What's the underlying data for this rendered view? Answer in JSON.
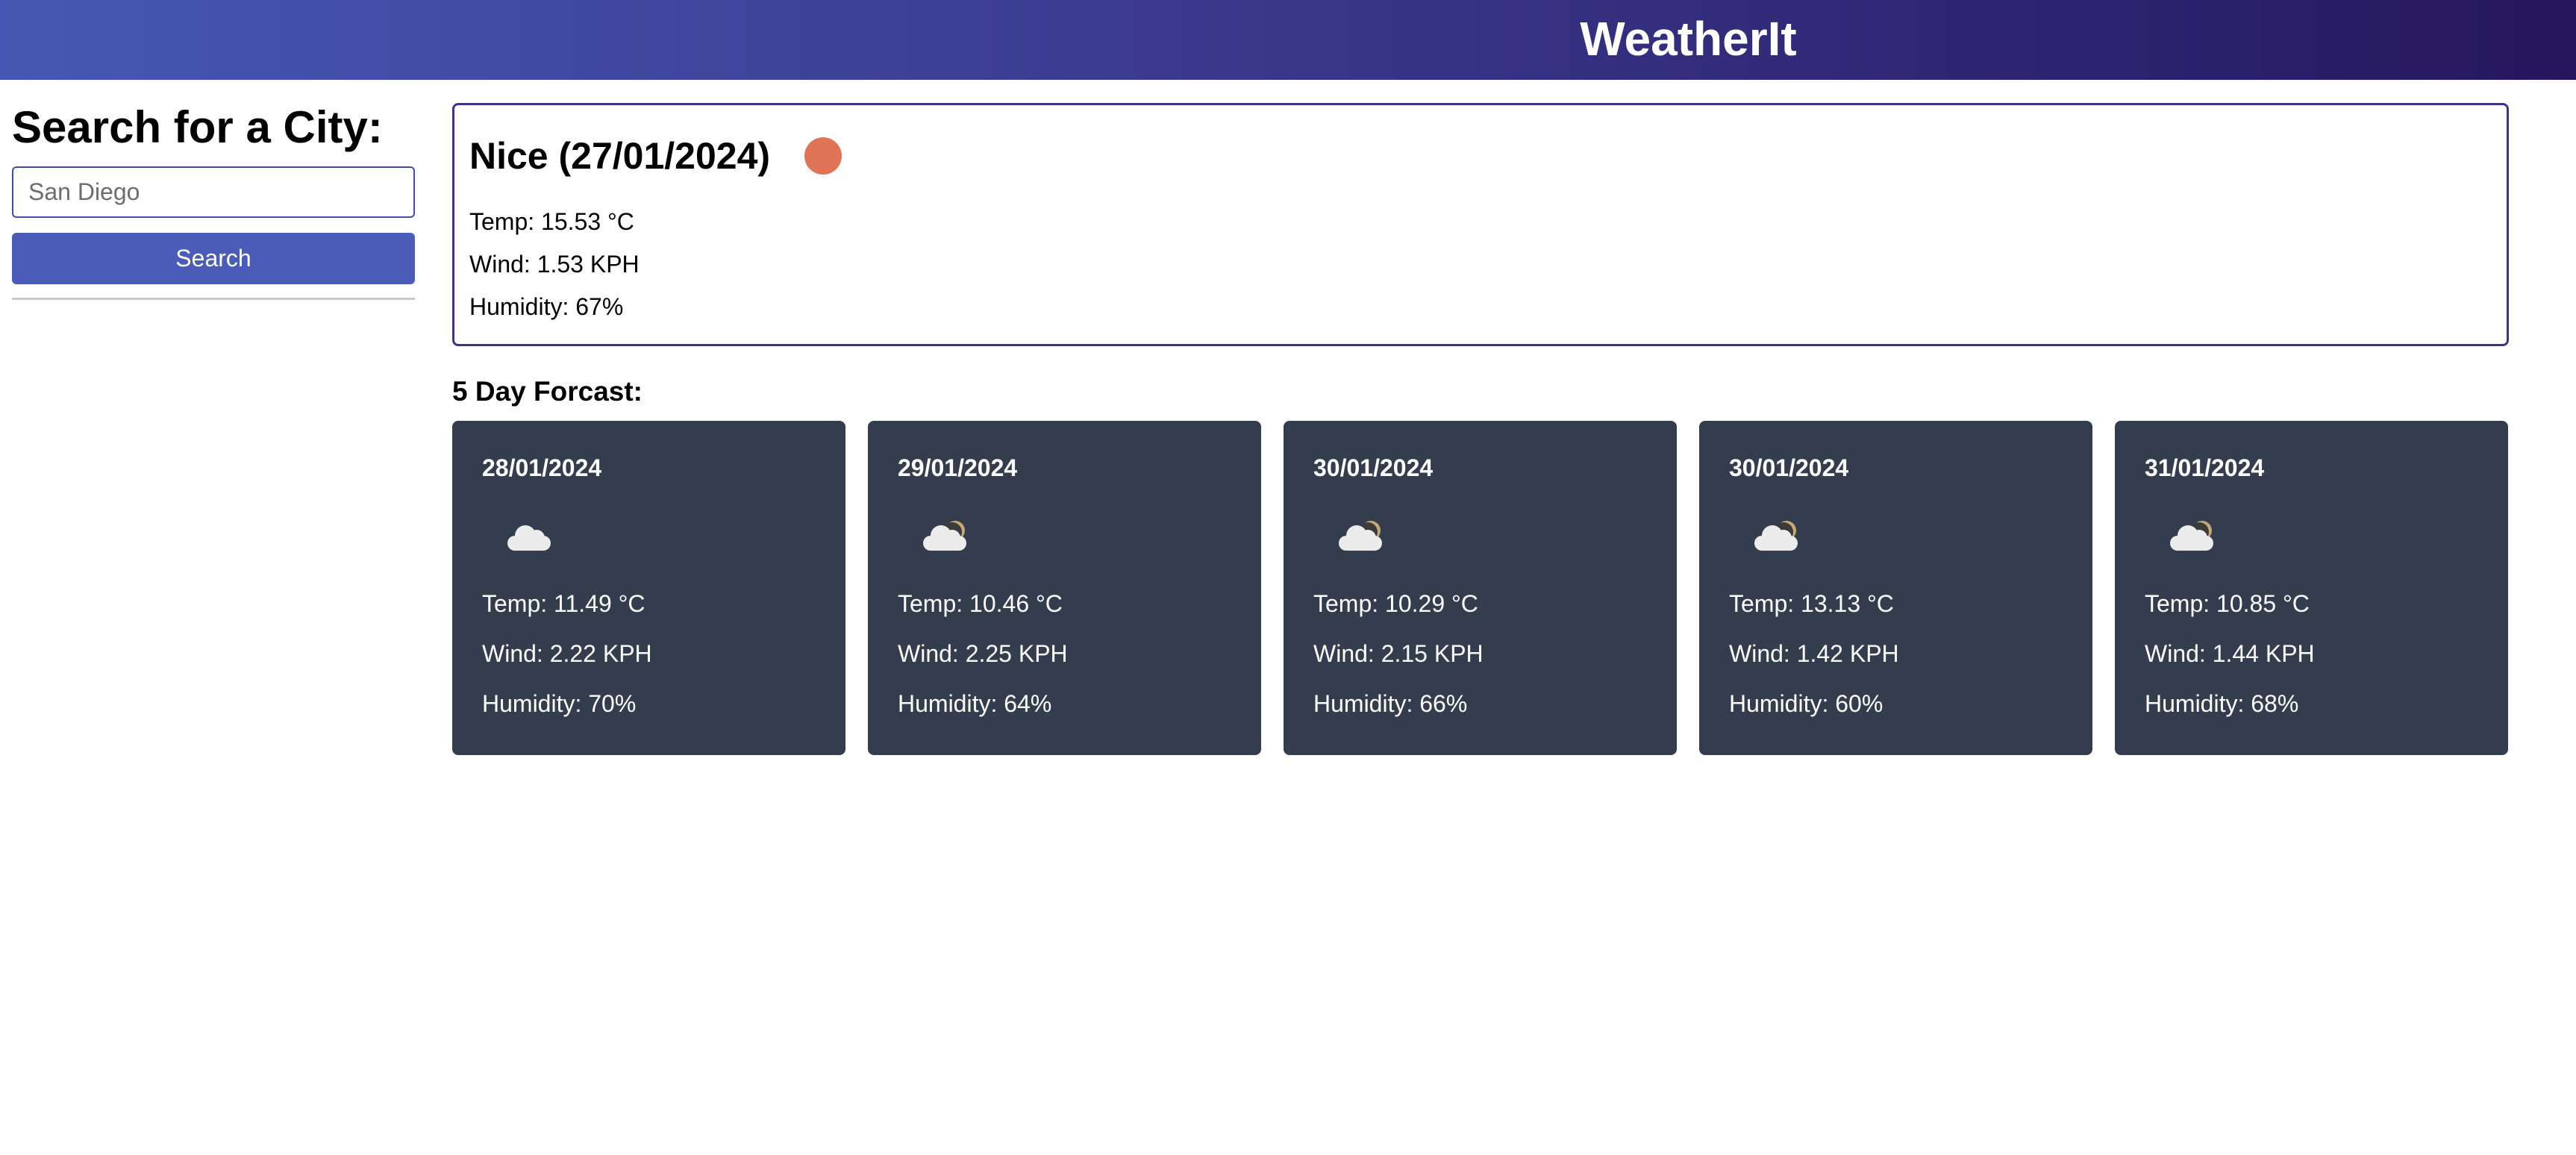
{
  "header": {
    "title": "WeatherIt",
    "gradient_colors": [
      "#4658b3",
      "#25175e"
    ]
  },
  "sidebar": {
    "heading": "Search for a City:",
    "search_placeholder": "San Diego",
    "search_value": "",
    "search_button_label": "Search",
    "accent_color": "#4a5cb8"
  },
  "current": {
    "title": "Nice (27/01/2024)",
    "icon": "sun-icon",
    "icon_color": "#e07456",
    "temp": "Temp: 15.53 °C",
    "wind": "Wind: 1.53 KPH",
    "humidity": "Humidity: 67%",
    "border_color": "#3b3586"
  },
  "forecast": {
    "heading": "5 Day Forcast:",
    "card_color": "#343d4e",
    "days": [
      {
        "date": "28/01/2024",
        "icon": "cloud-icon",
        "temp": "Temp: 11.49 °C",
        "wind": "Wind: 2.22 KPH",
        "humidity": "Humidity: 70%"
      },
      {
        "date": "29/01/2024",
        "icon": "cloud-moon-icon",
        "temp": "Temp: 10.46 °C",
        "wind": "Wind: 2.25 KPH",
        "humidity": "Humidity: 64%"
      },
      {
        "date": "30/01/2024",
        "icon": "cloud-moon-icon",
        "temp": "Temp: 10.29 °C",
        "wind": "Wind: 2.15 KPH",
        "humidity": "Humidity: 66%"
      },
      {
        "date": "30/01/2024",
        "icon": "cloud-moon-icon",
        "temp": "Temp: 13.13 °C",
        "wind": "Wind: 1.42 KPH",
        "humidity": "Humidity: 60%"
      },
      {
        "date": "31/01/2024",
        "icon": "cloud-moon-icon",
        "temp": "Temp: 10.85 °C",
        "wind": "Wind: 1.44 KPH",
        "humidity": "Humidity: 68%"
      }
    ]
  }
}
